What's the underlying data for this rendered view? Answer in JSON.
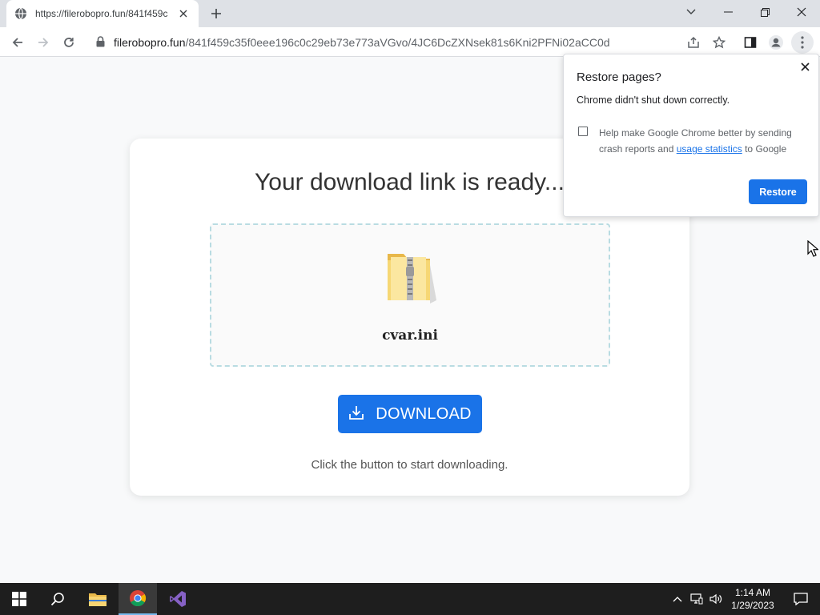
{
  "browser": {
    "tab_title": "https://filerobopro.fun/841f459c",
    "url_host": "filerobopro.fun",
    "url_path": "/841f459c35f0eee196c0c29eb73e773aVGvo/4JC6DcZXNsek81s6Kni2PFNi02aCC0d"
  },
  "page": {
    "title": "Your download link is ready...",
    "filename": "cvar.ini",
    "download_label": "DOWNLOAD",
    "hint": "Click the button to start downloading."
  },
  "popup": {
    "title": "Restore pages?",
    "message": "Chrome didn't shut down correctly.",
    "help_prefix": "Help make Google Chrome better by sending crash reports and ",
    "help_link": "usage statistics",
    "help_suffix": " to Google",
    "restore_label": "Restore"
  },
  "taskbar": {
    "time": "1:14 AM",
    "date": "1/29/2023"
  },
  "colors": {
    "accent": "#1a73e8",
    "tabstrip": "#dee1e6",
    "taskbar": "#1e1e1e"
  }
}
